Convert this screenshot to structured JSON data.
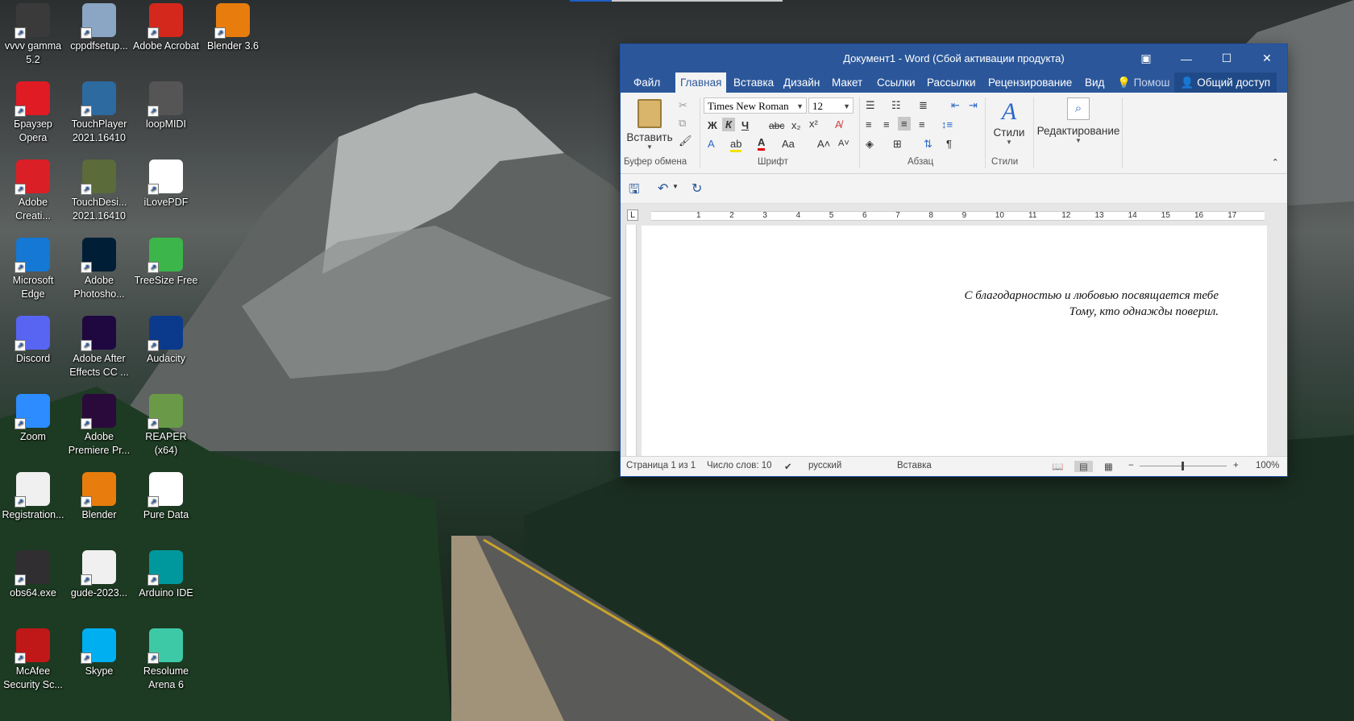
{
  "desktop": {
    "icons": [
      {
        "label": "vvvv gamma 5.2",
        "icon": "vvvv-icon",
        "color": "#3a3a3a"
      },
      {
        "label": "cppdfsetup...",
        "icon": "installer-icon",
        "color": "#8aa6c4"
      },
      {
        "label": "Adobe Acrobat",
        "icon": "acrobat-icon",
        "color": "#d4281c"
      },
      {
        "label": "Blender 3.6",
        "icon": "blender-icon",
        "color": "#e87d0d"
      },
      {
        "label": "Браузер Opera",
        "icon": "opera-icon",
        "color": "#e01b24"
      },
      {
        "label": "TouchPlayer 2021.16410",
        "icon": "touchplayer-icon",
        "color": "#2c6aa0"
      },
      {
        "label": "loopMIDI",
        "icon": "midi-icon",
        "color": "#555555"
      },
      {
        "label": "Adobe Creati...",
        "icon": "creative-cloud-icon",
        "color": "#da1f26"
      },
      {
        "label": "TouchDesi... 2021.16410",
        "icon": "touchdesigner-icon",
        "color": "#5b6b3a"
      },
      {
        "label": "iLovePDF",
        "icon": "ilovepdf-icon",
        "color": "#ffffff"
      },
      {
        "label": "Microsoft Edge",
        "icon": "edge-icon",
        "color": "#1478d4"
      },
      {
        "label": "Adobe Photosho...",
        "icon": "photoshop-icon",
        "color": "#001e36"
      },
      {
        "label": "TreeSize Free",
        "icon": "treesize-icon",
        "color": "#3cb54a"
      },
      {
        "label": "Discord",
        "icon": "discord-icon",
        "color": "#5865f2"
      },
      {
        "label": "Adobe After Effects CC ...",
        "icon": "after-effects-icon",
        "color": "#1f0740"
      },
      {
        "label": "Audacity",
        "icon": "audacity-icon",
        "color": "#0b3a8c"
      },
      {
        "label": "Zoom",
        "icon": "zoom-icon",
        "color": "#2d8cff"
      },
      {
        "label": "Adobe Premiere Pr...",
        "icon": "premiere-icon",
        "color": "#2a0a3a"
      },
      {
        "label": "REAPER (x64)",
        "icon": "reaper-icon",
        "color": "#6a9a48"
      },
      {
        "label": "Registration...",
        "icon": "document-icon",
        "color": "#f0f0f0"
      },
      {
        "label": "Blender",
        "icon": "blender-icon",
        "color": "#e87d0d"
      },
      {
        "label": "Pure Data",
        "icon": "puredata-icon",
        "color": "#ffffff"
      },
      {
        "label": "obs64.exe",
        "icon": "obs-icon",
        "color": "#302e31"
      },
      {
        "label": "gude-2023...",
        "icon": "document-icon",
        "color": "#f0f0f0"
      },
      {
        "label": "Arduino IDE",
        "icon": "arduino-icon",
        "color": "#00979d"
      },
      {
        "label": "McAfee Security Sc...",
        "icon": "mcafee-icon",
        "color": "#c01818"
      },
      {
        "label": "Skype",
        "icon": "skype-icon",
        "color": "#00aff0"
      },
      {
        "label": "Resolume Arena 6",
        "icon": "resolume-icon",
        "color": "#3ec9a6"
      }
    ]
  },
  "word": {
    "title": "Документ1 - Word (Сбой активации продукта)",
    "tabs": [
      "Файл",
      "Главная",
      "Вставка",
      "Дизайн",
      "Макет",
      "Ссылки",
      "Рассылки",
      "Рецензирование",
      "Вид"
    ],
    "help": "Помош",
    "share": "Общий доступ",
    "ribbon": {
      "paste_label": "Вставить",
      "font_name": "Times New Roman",
      "font_size": "12",
      "bold": "Ж",
      "italic": "К",
      "underline": "Ч",
      "strike": "abc",
      "styles_label": "Стили",
      "editing_label": "Редактирование",
      "groups": [
        "Буфер обмена",
        "Шрифт",
        "Абзац",
        "Стили"
      ]
    },
    "ruler_numbers": [
      "1",
      "2",
      "3",
      "4",
      "5",
      "6",
      "7",
      "8",
      "9",
      "10",
      "11",
      "12",
      "13",
      "14",
      "15",
      "16",
      "17"
    ],
    "document": {
      "lines": [
        "С благодарностью и любовью посвящается тебе",
        "Тому, кто однажды поверил."
      ]
    },
    "status": {
      "page": "Страница 1 из 1",
      "words": "Число слов: 10",
      "language": "русский",
      "mode": "Вставка",
      "zoom": "100%"
    },
    "colors": {
      "accent": "#2b579a",
      "ribbon": "#f3f3f3"
    }
  }
}
